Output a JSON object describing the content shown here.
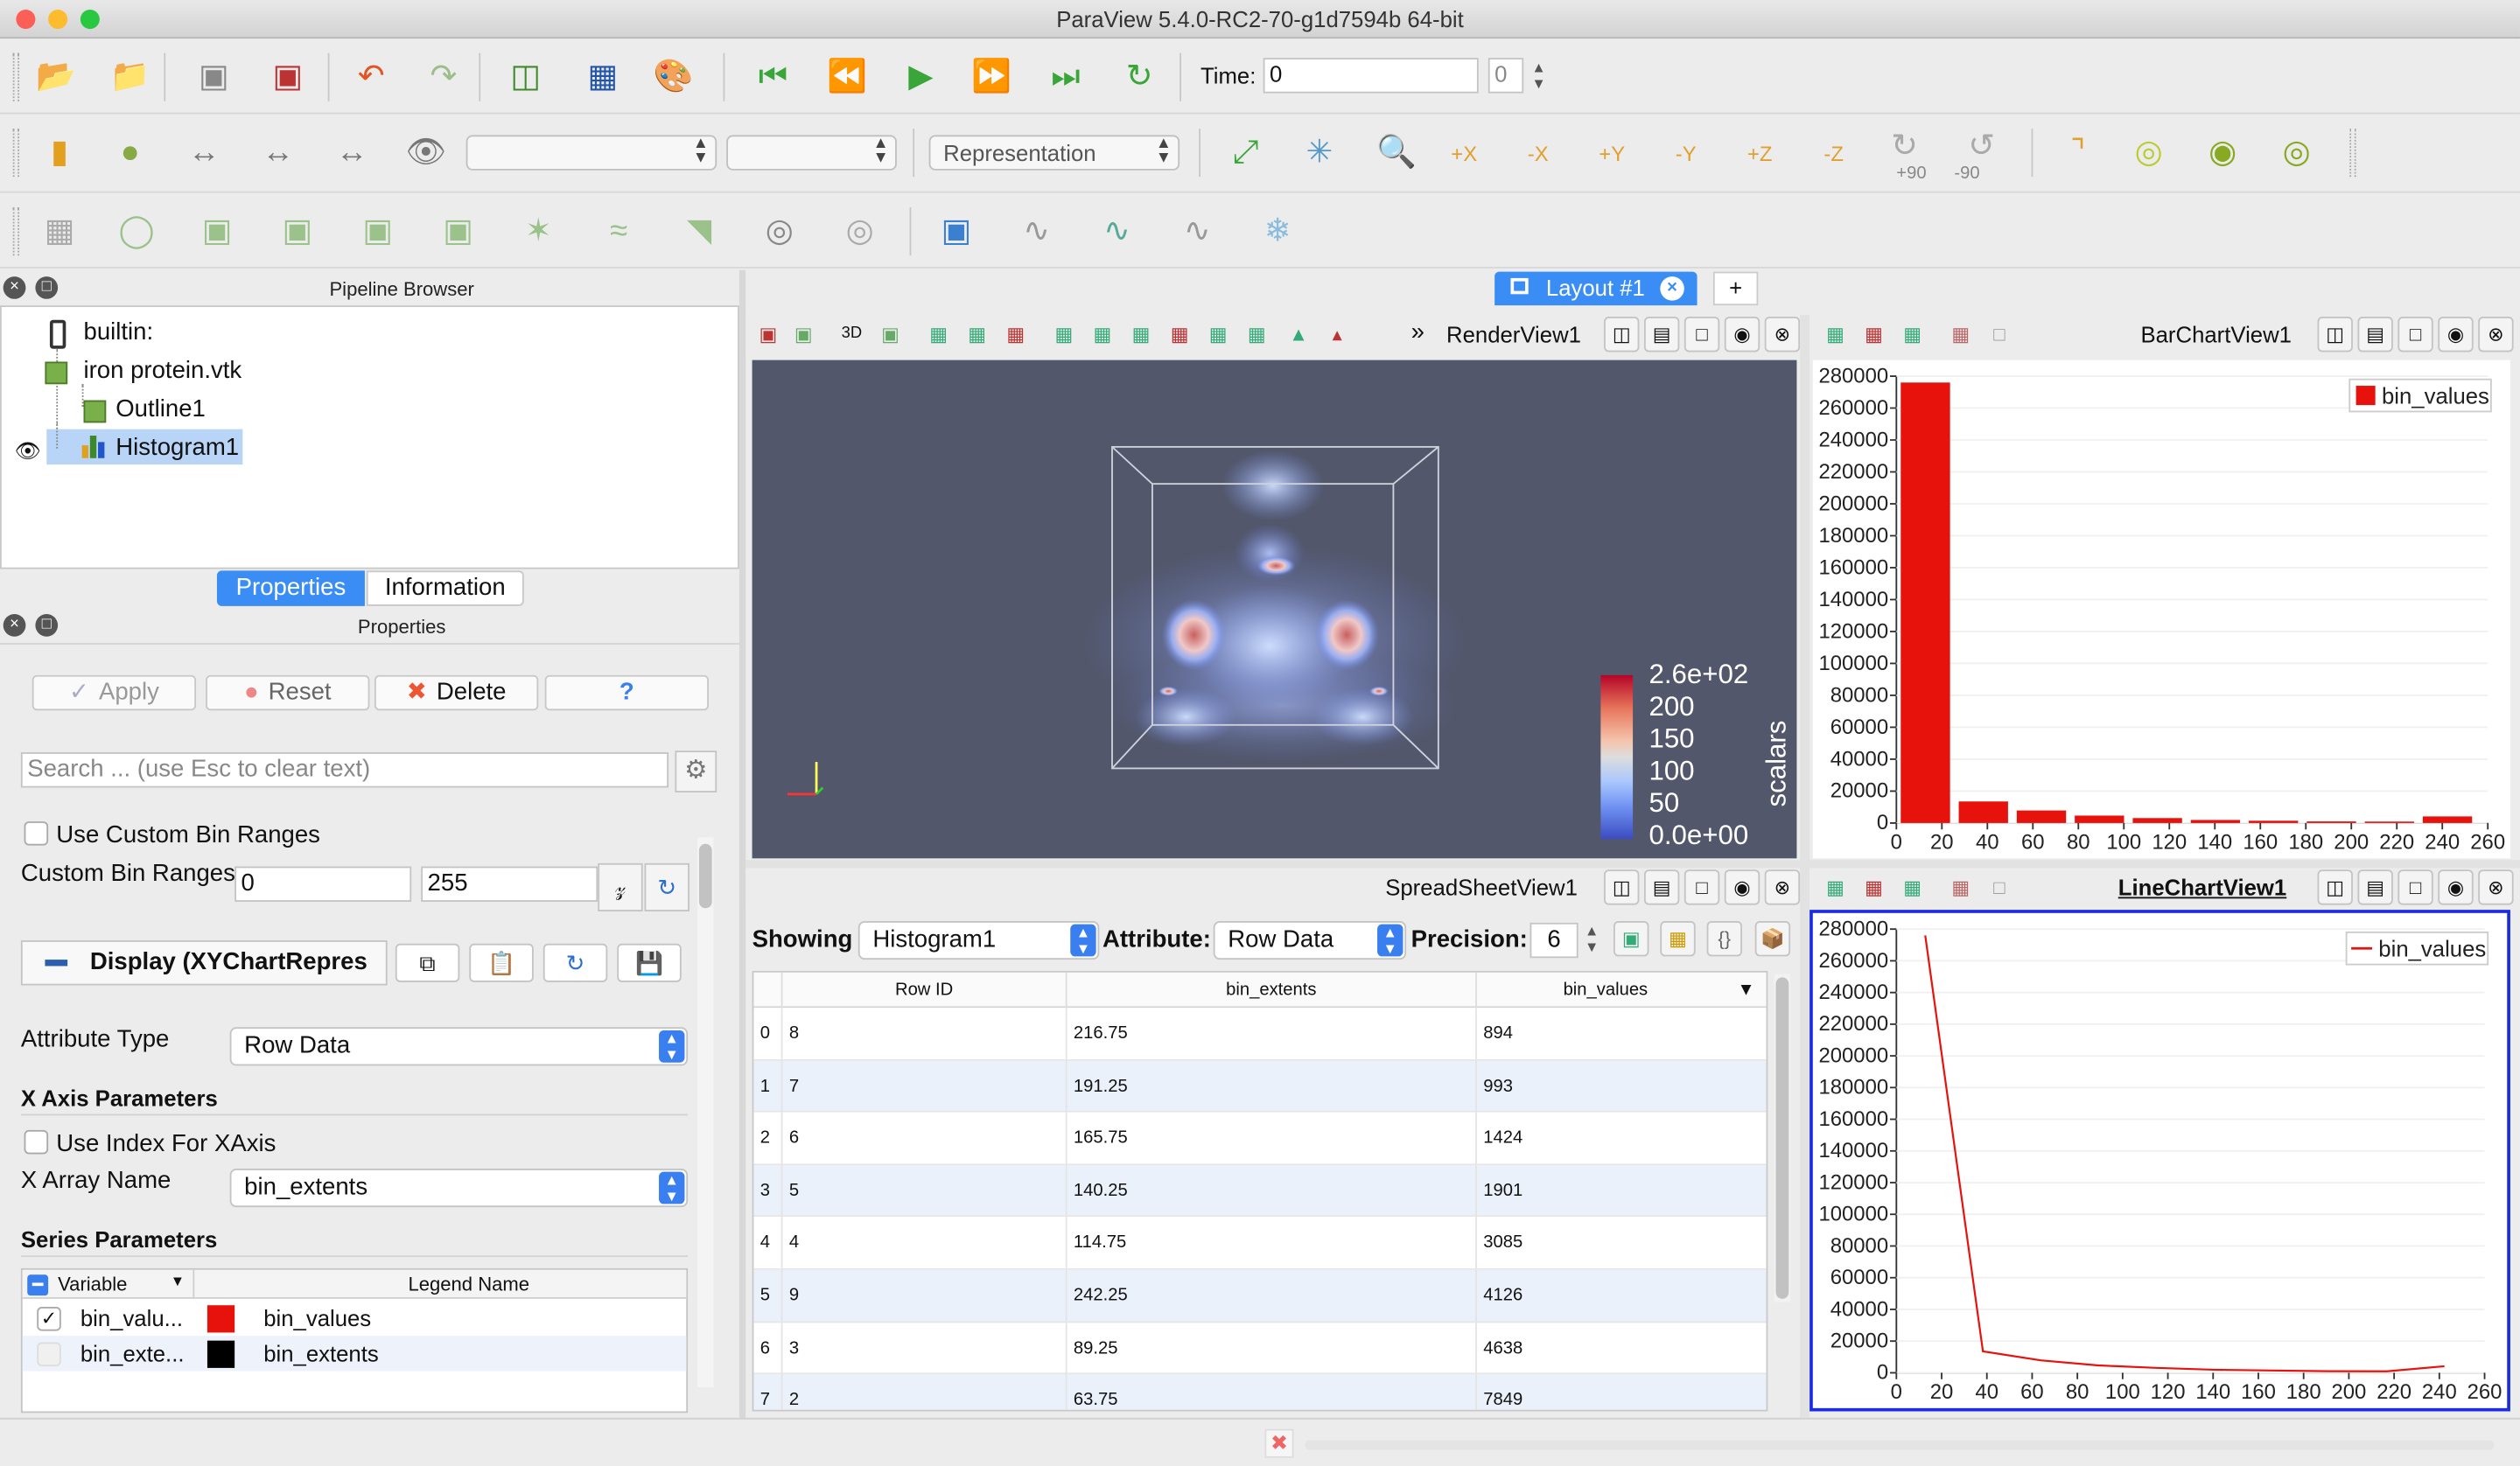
{
  "window": {
    "title": "ParaView 5.4.0-RC2-70-g1d7594b 64-bit"
  },
  "toolbar": {
    "time_label": "Time:",
    "time_value": "0",
    "timestep_value": "0",
    "representation_placeholder": "Representation",
    "rot_plus_90": "+90",
    "rot_minus_90": "-90",
    "axis_labels": [
      "+X",
      "-X",
      "+Y",
      "-Y",
      "+Z",
      "-Z"
    ]
  },
  "pipeline": {
    "title": "Pipeline Browser",
    "items": [
      {
        "label": "builtin:"
      },
      {
        "label": "iron protein.vtk"
      },
      {
        "label": "Outline1"
      },
      {
        "label": "Histogram1"
      }
    ]
  },
  "tabs": {
    "properties": "Properties",
    "information": "Information"
  },
  "properties": {
    "title": "Properties",
    "apply": "Apply",
    "reset": "Reset",
    "delete": "Delete",
    "help": "?",
    "search_placeholder": "Search ... (use Esc to clear text)",
    "use_custom_bin_ranges": "Use Custom Bin Ranges",
    "custom_bin_ranges_label": "Custom Bin Ranges",
    "bin_min": "0",
    "bin_max": "255",
    "display_section": "Display (XYChartRepres",
    "attribute_type_label": "Attribute Type",
    "attribute_type_value": "Row Data",
    "x_axis_header": "X Axis Parameters",
    "use_index_label": "Use Index For XAxis",
    "x_array_label": "X Array Name",
    "x_array_value": "bin_extents",
    "series_header": "Series Parameters",
    "series_cols": [
      "Variable",
      "Legend Name"
    ],
    "series": [
      {
        "variable": "bin_valu...",
        "legend": "bin_values",
        "color": "#e8120c",
        "checked": true
      },
      {
        "variable": "bin_exte...",
        "legend": "bin_extents",
        "color": "#000000",
        "checked": false
      }
    ]
  },
  "layout": {
    "tab": "Layout #1",
    "add": "+"
  },
  "render_view": {
    "title": "RenderView1",
    "mode": "3D",
    "colorbar_title": "scalars",
    "colorbar_labels": [
      "2.6e+02",
      "200",
      "150",
      "100",
      "50",
      "0.0e+00"
    ]
  },
  "bar_view": {
    "title": "BarChartView1"
  },
  "line_view": {
    "title": "LineChartView1"
  },
  "spreadsheet": {
    "title": "SpreadSheetView1",
    "showing_label": "Showing",
    "showing_value": "Histogram1",
    "attribute_label": "Attribute:",
    "attribute_value": "Row Data",
    "precision_label": "Precision:",
    "precision_value": "6",
    "columns": [
      "Row ID",
      "bin_extents",
      "bin_values"
    ],
    "rows": [
      {
        "idx": "0",
        "id": "8",
        "ext": "216.75",
        "val": "894"
      },
      {
        "idx": "1",
        "id": "7",
        "ext": "191.25",
        "val": "993"
      },
      {
        "idx": "2",
        "id": "6",
        "ext": "165.75",
        "val": "1424"
      },
      {
        "idx": "3",
        "id": "5",
        "ext": "140.25",
        "val": "1901"
      },
      {
        "idx": "4",
        "id": "4",
        "ext": "114.75",
        "val": "3085"
      },
      {
        "idx": "5",
        "id": "9",
        "ext": "242.25",
        "val": "4126"
      },
      {
        "idx": "6",
        "id": "3",
        "ext": "89.25",
        "val": "4638"
      },
      {
        "idx": "7",
        "id": "2",
        "ext": "63.75",
        "val": "7849"
      }
    ]
  },
  "colors": {
    "accent": "#3a7ff0",
    "bar": "#e8120c",
    "line": "#e8120c",
    "render_bg": "#52576b",
    "active_border": "#1a2be0"
  },
  "chart_data": [
    {
      "type": "bar",
      "title": "BarChartView1",
      "series": [
        {
          "name": "bin_values",
          "x": [
            12.75,
            38.25,
            63.75,
            89.25,
            114.75,
            140.25,
            165.75,
            191.25,
            216.75,
            242.25
          ],
          "values": [
            276000,
            13500,
            7849,
            4638,
            3085,
            1901,
            1424,
            993,
            894,
            4126
          ]
        }
      ],
      "xlim": [
        0,
        260
      ],
      "ylim": [
        0,
        280000
      ],
      "xticks": [
        "0",
        "20",
        "40",
        "60",
        "80",
        "100",
        "120",
        "140",
        "160",
        "180",
        "200",
        "220",
        "240",
        "260"
      ],
      "yticks": [
        "0",
        "20000",
        "40000",
        "60000",
        "80000",
        "100000",
        "120000",
        "140000",
        "160000",
        "180000",
        "200000",
        "220000",
        "240000",
        "260000",
        "280000"
      ],
      "legend": "top-right"
    },
    {
      "type": "line",
      "title": "LineChartView1",
      "series": [
        {
          "name": "bin_values",
          "x": [
            12.75,
            38.25,
            63.75,
            89.25,
            114.75,
            140.25,
            165.75,
            191.25,
            216.75,
            242.25
          ],
          "values": [
            276000,
            13500,
            7849,
            4638,
            3085,
            1901,
            1424,
            993,
            894,
            4126
          ]
        }
      ],
      "xlim": [
        0,
        260
      ],
      "ylim": [
        0,
        280000
      ],
      "xticks": [
        "0",
        "20",
        "40",
        "60",
        "80",
        "100",
        "120",
        "140",
        "160",
        "180",
        "200",
        "220",
        "240",
        "260"
      ],
      "yticks": [
        "0",
        "20000",
        "40000",
        "60000",
        "80000",
        "100000",
        "120000",
        "140000",
        "160000",
        "180000",
        "200000",
        "220000",
        "240000",
        "260000",
        "280000"
      ],
      "legend": "top-right"
    }
  ]
}
